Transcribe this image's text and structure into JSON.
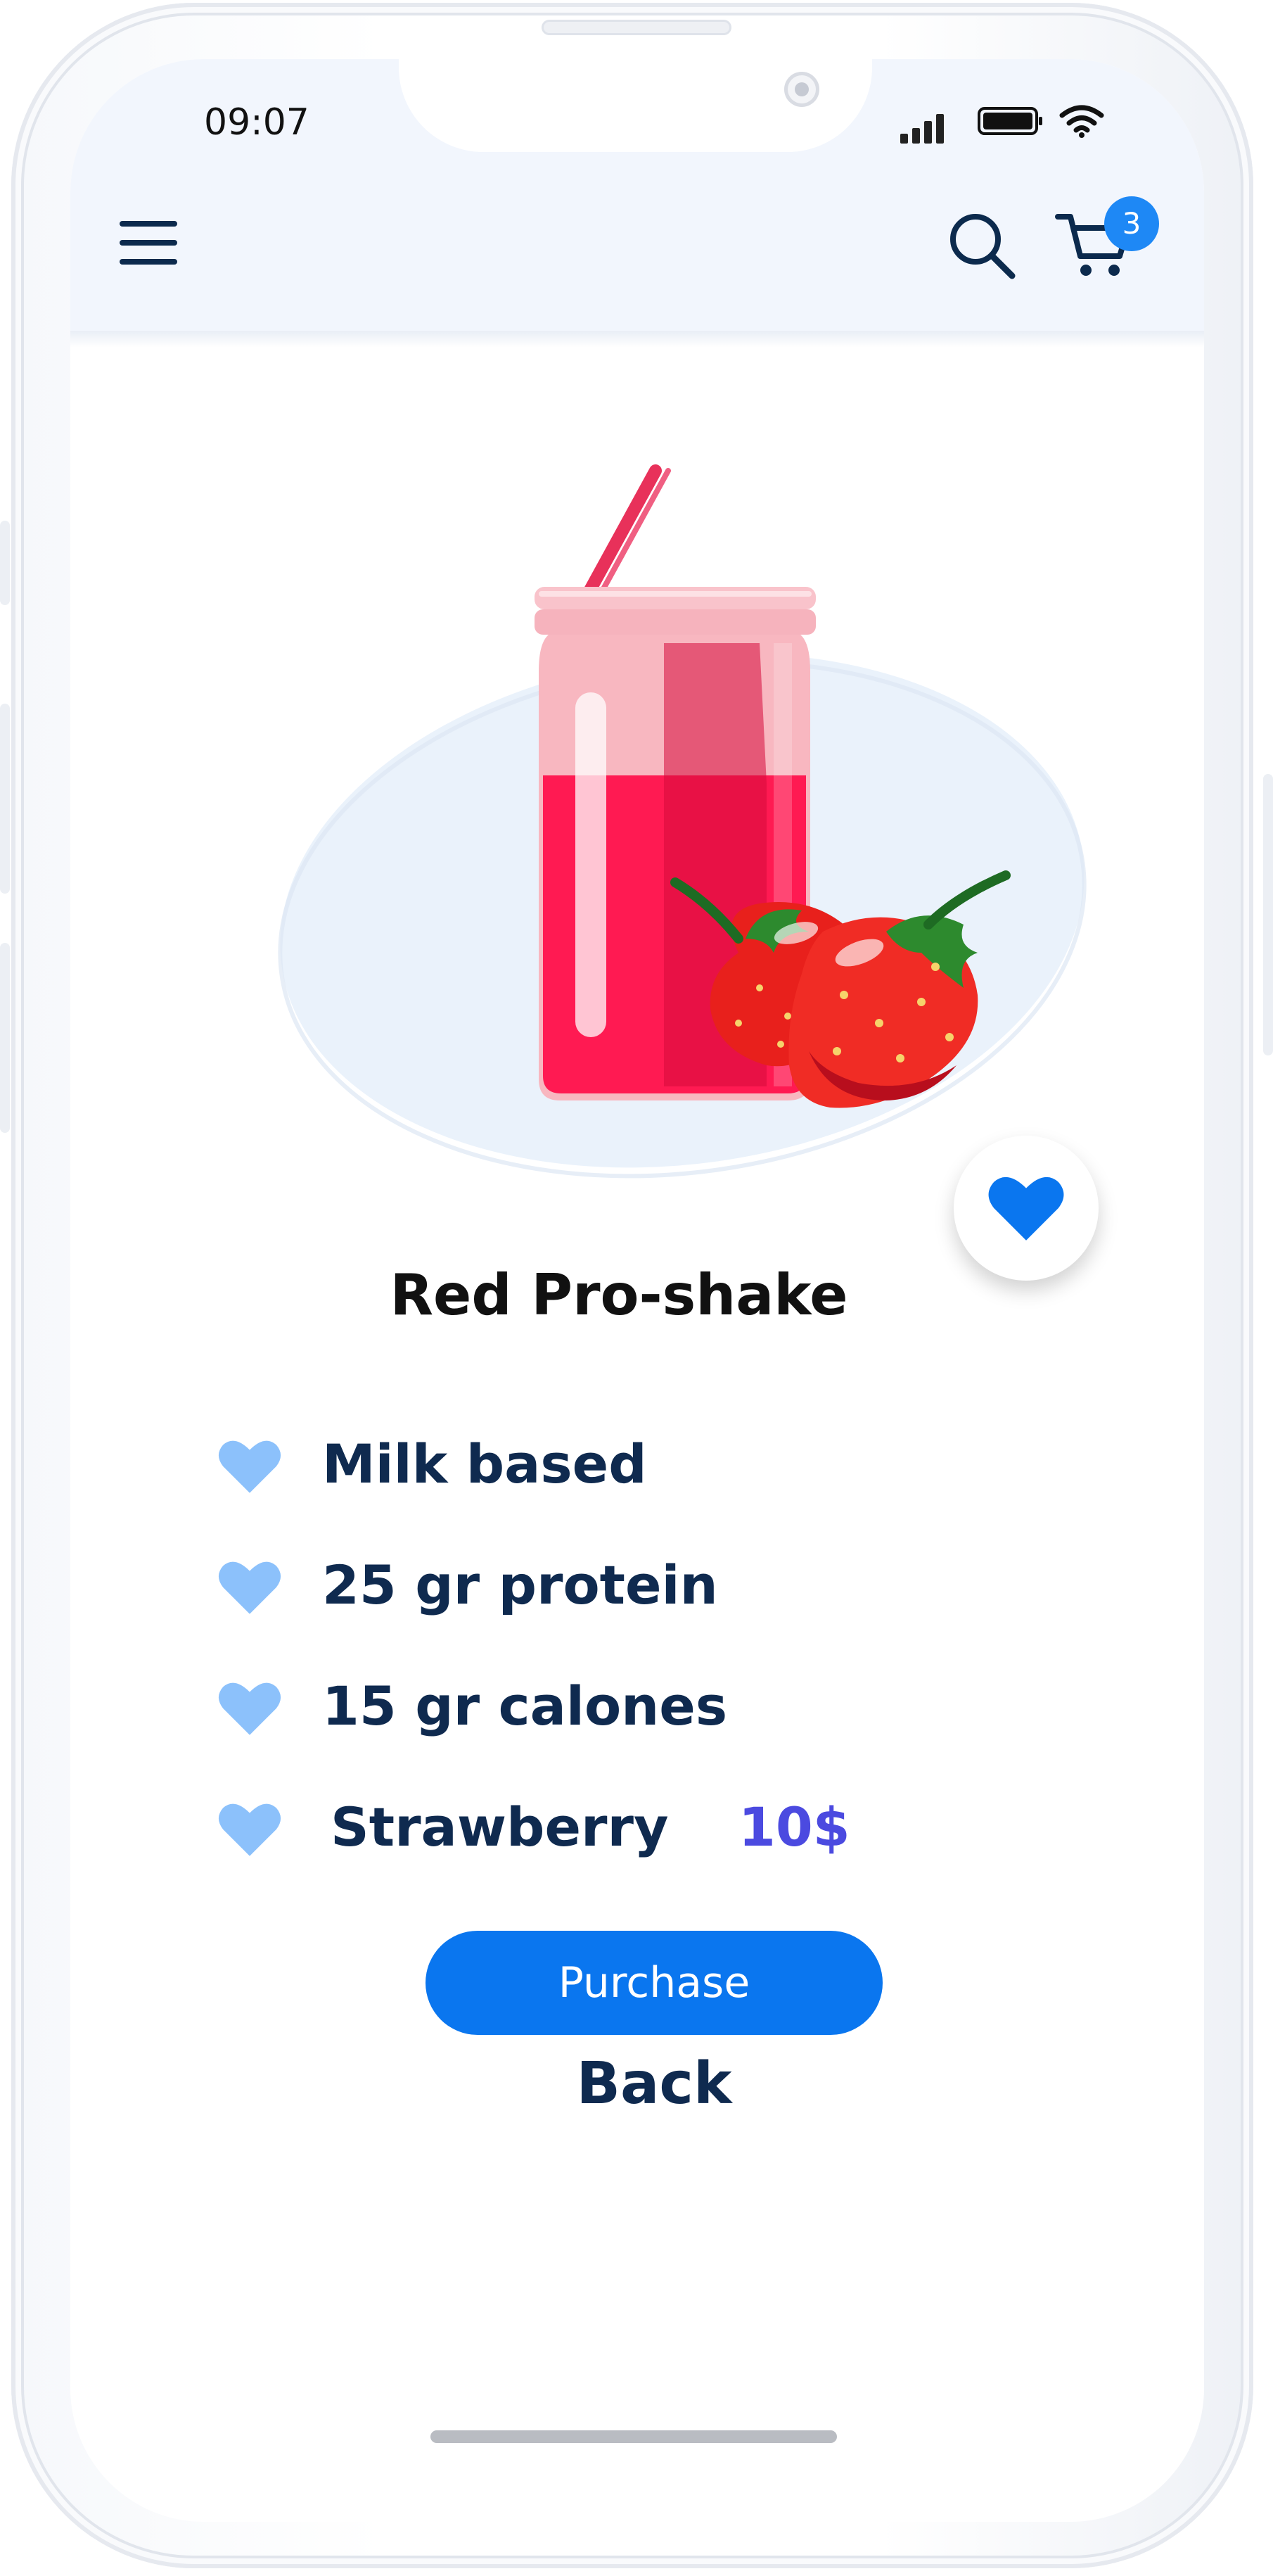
{
  "status_bar": {
    "time": "09:07"
  },
  "header": {
    "cart_count": "3"
  },
  "product": {
    "title": "Red Pro-shake",
    "features": [
      "Milk based",
      "25 gr protein",
      "15 gr calones",
      "Strawberry"
    ],
    "price": "10$"
  },
  "actions": {
    "purchase_label": "Purchase",
    "back_label": "Back"
  },
  "icons": {
    "menu": "hamburger-icon",
    "search": "search-icon",
    "cart": "cart-icon",
    "favorite": "heart-icon",
    "feature_bullet": "heart-icon"
  },
  "colors": {
    "accent": "#0a76ef",
    "heading": "#0f2a4f",
    "price": "#4b4ae0",
    "bullet_heart": "#8cc1fb",
    "header_bg": "#f2f6fd",
    "plate": "#eaf2fb"
  }
}
